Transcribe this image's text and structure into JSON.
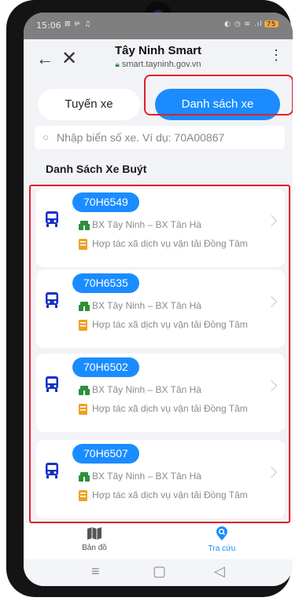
{
  "status_bar": {
    "time": "15:06",
    "left_icons": "⊠ ⊭ ♫",
    "right_icons": "◐ ◷ ≋ .ıl",
    "battery": "75"
  },
  "app_bar": {
    "title": "Tây Ninh Smart",
    "url": "smart.tayninh.gov.vn",
    "back_icon": "←",
    "close_icon": "✕",
    "menu_icon": "⋮"
  },
  "tabs": {
    "routes": "Tuyến xe",
    "buses": "Danh sách xe",
    "active": "buses"
  },
  "search": {
    "placeholder": "Nhập biển số xe. Ví dụ: 70A00867",
    "value": ""
  },
  "section_title": "Danh Sách Xe Buýt",
  "buses": [
    {
      "plate": "70H6549",
      "route": "BX Tây Ninh – BX Tân Hà",
      "operator": "Hợp tác xã dịch vụ vận tải Đồng Tâm"
    },
    {
      "plate": "70H6535",
      "route": "BX Tây Ninh – BX Tân Hà",
      "operator": "Hợp tác xã dịch vụ vận tải Đồng Tâm"
    },
    {
      "plate": "70H6502",
      "route": "BX Tây Ninh – BX Tân Hà",
      "operator": "Hợp tác xã dịch vụ vận tải Đồng Tâm"
    },
    {
      "plate": "70H6507",
      "route": "BX Tây Ninh – BX Tân Hà",
      "operator": "Hợp tác xã dịch vụ vận tải Đồng Tâm"
    }
  ],
  "bottom_nav": {
    "map": "Bản đồ",
    "lookup": "Tra cứu",
    "active": "lookup"
  },
  "system_nav": {
    "menu": "≡",
    "home": "▢",
    "back": "◁"
  },
  "colors": {
    "accent": "#1a8cff",
    "highlight": "#e0202a",
    "bus_icon": "#1530c8",
    "route_icon": "#2f8f3a",
    "coop_icon": "#f0a020"
  }
}
